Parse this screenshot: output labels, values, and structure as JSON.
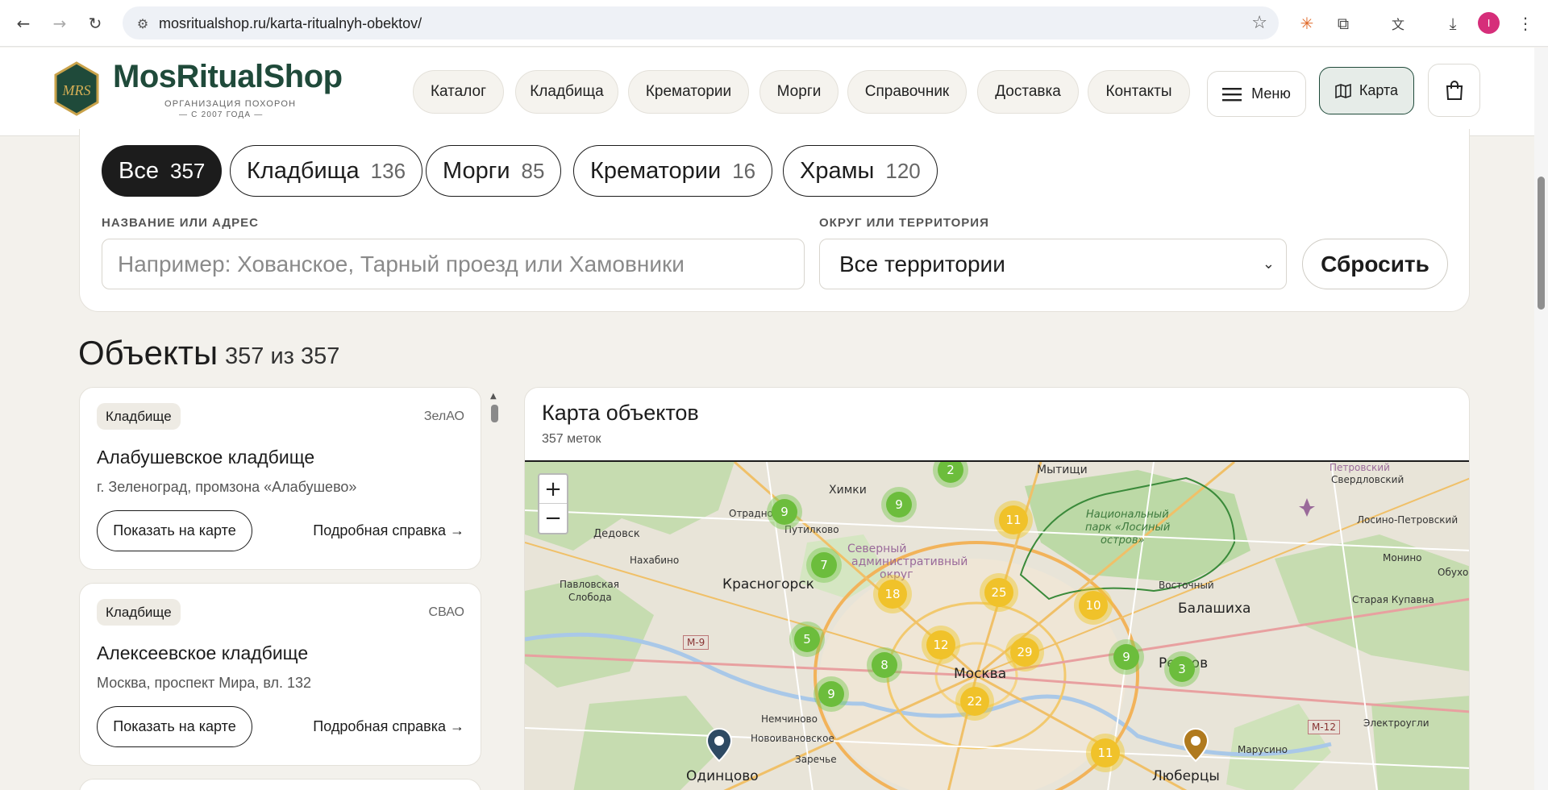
{
  "browser": {
    "url": "mosritualshop.ru/karta-ritualnyh-obektov/",
    "profile_initial": "I"
  },
  "header": {
    "logo_title": "MosRitualShop",
    "logo_sub1": "ОРГАНИЗАЦИЯ ПОХОРОН",
    "logo_sub2": "— С 2007 ГОДА —",
    "logo_monogram": "MRS",
    "nav": [
      "Каталог",
      "Кладбища",
      "Крематории",
      "Морги",
      "Справочник",
      "Доставка",
      "Контакты"
    ],
    "menu_label": "Меню",
    "map_label": "Карта"
  },
  "filters": {
    "chips": [
      {
        "label": "Все",
        "count": "357"
      },
      {
        "label": "Кладбища",
        "count": "136"
      },
      {
        "label": "Морги",
        "count": "85"
      },
      {
        "label": "Крематории",
        "count": "16"
      },
      {
        "label": "Храмы",
        "count": "120"
      }
    ],
    "name_label": "НАЗВАНИЕ ИЛИ АДРЕС",
    "name_placeholder": "Например: Хованское, Тарный проезд или Хамовники",
    "district_label": "ОКРУГ ИЛИ ТЕРРИТОРИЯ",
    "district_value": "Все территории",
    "reset_label": "Сбросить"
  },
  "objects": {
    "title": "Объекты",
    "count": "357 из 357"
  },
  "cards": [
    {
      "tag": "Кладбище",
      "area": "ЗелАО",
      "name": "Алабушевское кладбище",
      "address": "г. Зеленоград, промзона «Алабушево»",
      "show": "Показать на карте",
      "details": "Подробная справка →"
    },
    {
      "tag": "Кладбище",
      "area": "СВАО",
      "name": "Алексеевское кладбище",
      "address": "Москва, проспект Мира, вл. 132",
      "show": "Показать на карте",
      "details": "Подробная справка →"
    }
  ],
  "map": {
    "title": "Карта объектов",
    "subtitle": "357 меток",
    "zoom_in": "+",
    "zoom_out": "−",
    "labels": {
      "mytishchi": "Мытищи",
      "khimki": "Химки",
      "sverdlovsky": "Свердловский",
      "petrovsky": "Петровский",
      "national_park_1": "Национальный",
      "national_park_2": "парк «Лосиный",
      "national_park_3": "остров»",
      "otradnoe": "Отрадное",
      "putilkovo": "Путилково",
      "dedovsk": "Дедовск",
      "nakhabino": "Нахабино",
      "severny_1": "Северный",
      "severny_2": "административный",
      "severny_3": "округ",
      "losino": "Лосино-Петровский",
      "monino": "Монино",
      "obukhovo": "Обухово",
      "pavlovskaya_1": "Павловская",
      "pavlovskaya_2": "Слобода",
      "krasnogorsk": "Красногорск",
      "vostochny": "Восточный",
      "balashikha": "Балашиха",
      "staraya_kupavna": "Старая Купавна",
      "m9": "М-9",
      "moskva": "Москва",
      "reutov": "Реутов",
      "m12": "М-12",
      "elektrougli": "Электроугли",
      "nemchinovo": "Немчиновo",
      "novoivankovskoe": "Новоивановское",
      "zarechye": "Заречье",
      "odintsovo": "Одинцово",
      "lyubertsy": "Люберцы",
      "marusino": "Марусино"
    },
    "clusters": [
      {
        "count": "2",
        "color": "green"
      },
      {
        "count": "9",
        "color": "green"
      },
      {
        "count": "9",
        "color": "green"
      },
      {
        "count": "11",
        "color": "yellow"
      },
      {
        "count": "7",
        "color": "green"
      },
      {
        "count": "18",
        "color": "yellow"
      },
      {
        "count": "25",
        "color": "yellow"
      },
      {
        "count": "10",
        "color": "yellow"
      },
      {
        "count": "5",
        "color": "green"
      },
      {
        "count": "12",
        "color": "yellow"
      },
      {
        "count": "29",
        "color": "yellow"
      },
      {
        "count": "9",
        "color": "green"
      },
      {
        "count": "3",
        "color": "green"
      },
      {
        "count": "8",
        "color": "green"
      },
      {
        "count": "9",
        "color": "green"
      },
      {
        "count": "22",
        "color": "yellow"
      },
      {
        "count": "11",
        "color": "yellow"
      }
    ]
  },
  "colors": {
    "brand": "#1f4a3a",
    "cluster_green": "#6cbd3c",
    "cluster_yellow": "#f0c22a",
    "pin_blue": "#2e4a63",
    "pin_brown": "#b07a1e"
  }
}
